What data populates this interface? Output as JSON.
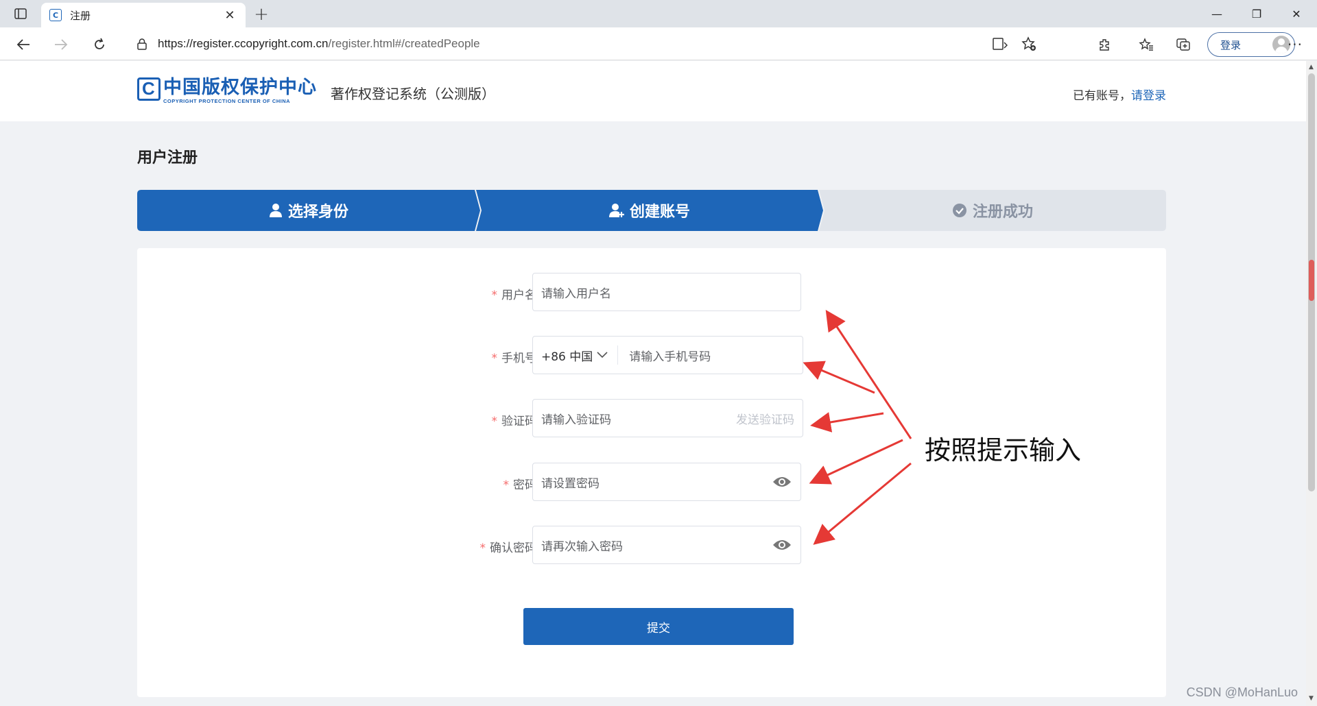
{
  "browser": {
    "tab_title": "注册",
    "url_host": "https://register.ccopyright.com.cn",
    "url_path": "/register.html#/createdPeople",
    "login_label": "登录",
    "more_label": "···"
  },
  "header": {
    "logo_cn": "中国版权保护中心",
    "logo_en": "COPYRIGHT PROTECTION CENTER OF CHINA",
    "logo_mark": "CPCC",
    "system_name": "著作权登记系统（公测版）",
    "have_account": "已有账号，",
    "login_link": "请登录"
  },
  "page_title": "用户注册",
  "steps": [
    {
      "label": "选择身份",
      "state": "done"
    },
    {
      "label": "创建账号",
      "state": "active"
    },
    {
      "label": "注册成功",
      "state": "pending"
    }
  ],
  "form": {
    "username": {
      "label": "用户名",
      "placeholder": "请输入用户名"
    },
    "phone": {
      "label": "手机号",
      "country": "+86 中国",
      "placeholder": "请输入手机号码"
    },
    "code": {
      "label": "验证码",
      "placeholder": "请输入验证码",
      "send_label": "发送验证码"
    },
    "password": {
      "label": "密码",
      "placeholder": "请设置密码"
    },
    "confirm": {
      "label": "确认密码",
      "placeholder": "请再次输入密码"
    },
    "required_mark": "*",
    "submit_label": "提交"
  },
  "annotation": "按照提示输入",
  "watermark": "CSDN @MoHanLuo",
  "colors": {
    "primary": "#1e66b8",
    "step_pending": "#e0e4ea",
    "required": "#f56c6c",
    "arrow": "#e53935"
  }
}
